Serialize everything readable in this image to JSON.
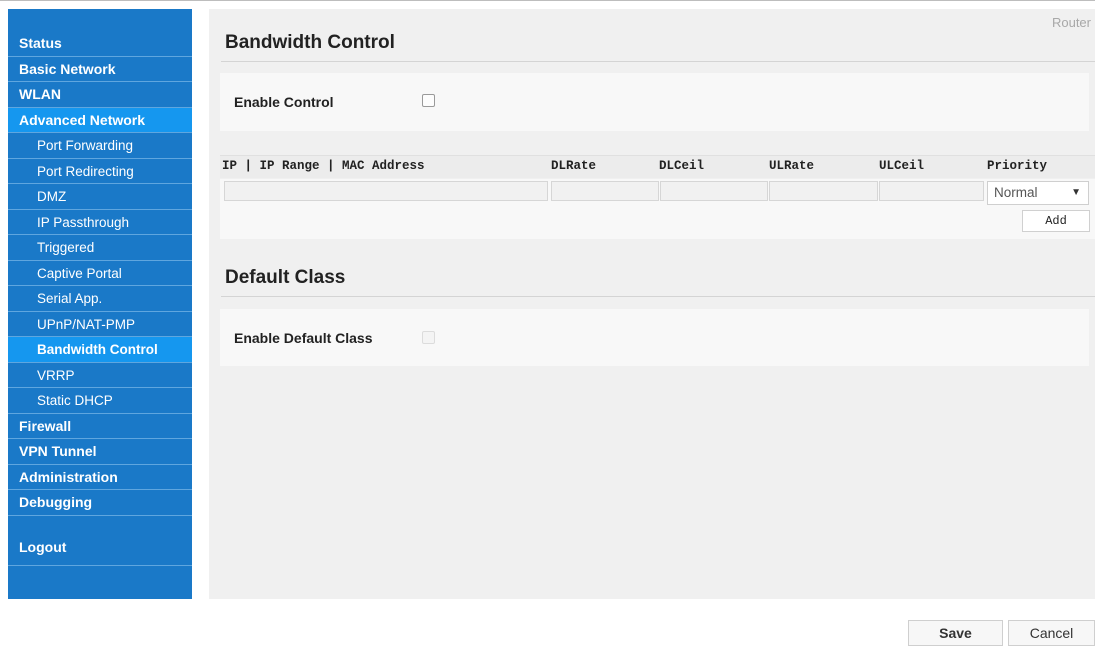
{
  "sidebar": {
    "items": [
      {
        "label": "Status"
      },
      {
        "label": "Basic Network"
      },
      {
        "label": "WLAN"
      },
      {
        "label": "Advanced Network"
      },
      {
        "label": "Port Forwarding"
      },
      {
        "label": "Port Redirecting"
      },
      {
        "label": "DMZ"
      },
      {
        "label": "IP Passthrough"
      },
      {
        "label": "Triggered"
      },
      {
        "label": "Captive Portal"
      },
      {
        "label": "Serial App."
      },
      {
        "label": "UPnP/NAT-PMP"
      },
      {
        "label": "Bandwidth Control"
      },
      {
        "label": "VRRP"
      },
      {
        "label": "Static DHCP"
      },
      {
        "label": "Firewall"
      },
      {
        "label": "VPN Tunnel"
      },
      {
        "label": "Administration"
      },
      {
        "label": "Debugging"
      },
      {
        "label": "Logout"
      }
    ],
    "active_item": "Bandwidth Control",
    "colors": {
      "background": "#1a79c8",
      "active": "#1597ef"
    }
  },
  "header": {
    "router_label": "Router"
  },
  "bandwidth": {
    "title": "Bandwidth Control",
    "enable_label": "Enable Control",
    "enabled": false
  },
  "table": {
    "headers": [
      "IP | IP Range | MAC Address",
      "DLRate",
      "DLCeil",
      "ULRate",
      "ULCeil",
      "Priority"
    ],
    "row": {
      "ip": "",
      "dlrate": "",
      "dlceil": "",
      "ulrate": "",
      "ulceil": "",
      "priority": "Normal"
    },
    "add_label": "Add"
  },
  "default_class": {
    "title": "Default Class",
    "enable_label": "Enable Default Class",
    "enabled": false,
    "disabled": true
  },
  "footer": {
    "save_label": "Save",
    "cancel_label": "Cancel"
  }
}
